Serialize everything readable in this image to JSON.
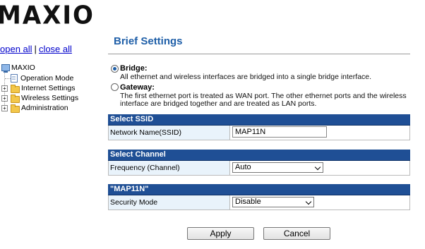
{
  "brand": {
    "logo_text": "MAXIO"
  },
  "tree_controls": {
    "open_all": "open all",
    "separator": "|",
    "close_all": "close all"
  },
  "tree": {
    "root": "MAXIO",
    "items": [
      {
        "label": "Operation Mode",
        "icon": "document-icon",
        "expandable": false
      },
      {
        "label": "Internet Settings",
        "icon": "folder-icon",
        "expandable": true
      },
      {
        "label": "Wireless Settings",
        "icon": "folder-icon",
        "expandable": true
      },
      {
        "label": "Administration",
        "icon": "folder-icon",
        "expandable": true
      }
    ]
  },
  "page": {
    "title": "Brief Settings"
  },
  "mode": {
    "selected": "Bridge",
    "bridge": {
      "title": "Bridge:",
      "desc": "All ethernet and wireless interfaces are bridged into a single bridge interface."
    },
    "gateway": {
      "title": "Gateway:",
      "desc_line1": "The first ethernet port is treated as WAN port. The other ethernet ports and the wireless",
      "desc_line2": "interface are bridged together and are treated as LAN ports."
    }
  },
  "ssid": {
    "header": "Select SSID",
    "label": "Network Name(SSID)",
    "value": "MAP11N"
  },
  "channel": {
    "header": "Select Channel",
    "label": "Frequency (Channel)",
    "value": "Auto"
  },
  "security": {
    "header": "\"MAP11N\"",
    "label": "Security Mode",
    "value": "Disable"
  },
  "buttons": {
    "apply": "Apply",
    "cancel": "Cancel"
  },
  "colors": {
    "header_bg": "#1f4f95",
    "title": "#1f5fa8",
    "label_bg": "#e9f3fb",
    "link": "#0000cc"
  }
}
